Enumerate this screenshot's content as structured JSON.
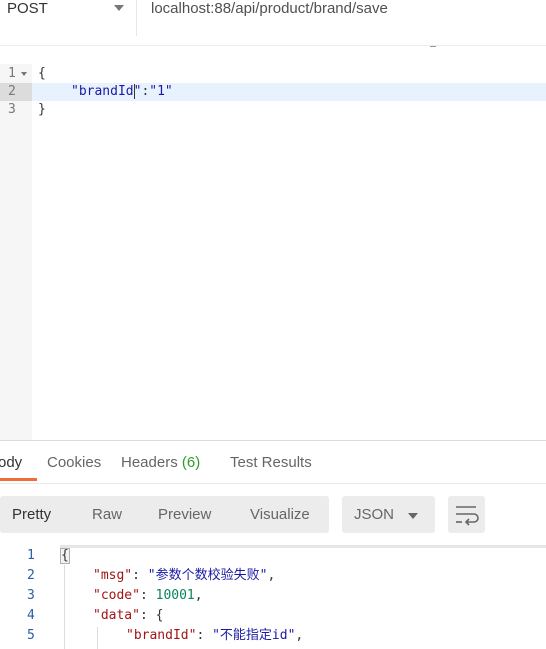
{
  "request": {
    "method": "POST",
    "url": "localhost:88/api/product/brand/save"
  },
  "body_editor": {
    "line_numbers": [
      "1",
      "2",
      "3"
    ],
    "line1": "{",
    "line2_key": "\"brandId",
    "line2_rest_a": "\"",
    "line2_colon": ":",
    "line2_value": "\"1\"",
    "line3": "}"
  },
  "response_tabs": {
    "body": "ody",
    "cookies": "Cookies",
    "headers": "Headers",
    "headers_count": "(6)",
    "test_results": "Test Results"
  },
  "view_modes": {
    "pretty": "Pretty",
    "raw": "Raw",
    "preview": "Preview",
    "visualize": "Visualize",
    "format": "JSON"
  },
  "response_body": {
    "line_numbers": [
      "1",
      "2",
      "3",
      "4",
      "5"
    ],
    "l1": "{",
    "msg_key": "\"msg\"",
    "msg_val": "\"参数个数校验失败\"",
    "code_key": "\"code\"",
    "code_val": "10001",
    "data_key": "\"data\"",
    "data_open": "{",
    "brandId_key": "\"brandId\"",
    "brandId_val": "\"不能指定id\""
  },
  "colors": {
    "accent": "#f26b3a",
    "count_green": "#2d9d2a",
    "line_number_blue": "#2a5ea8"
  }
}
